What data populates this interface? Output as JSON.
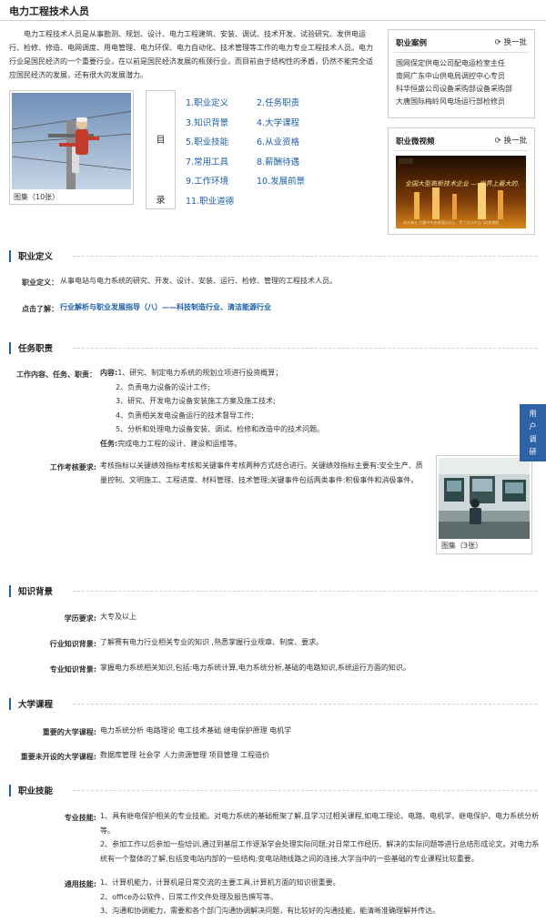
{
  "page_title": "电力工程技术人员",
  "intro": "电力工程技术人员是从事勘测、规划、设计、电力工程建筑、安装、调试、技术开发、试验研究、发供电运行、检修、修造、电网调度、用电管理、电力环保、电力自动化、技术管理等工作的电力专业工程技术人员。电力行业是国民经济的一个重要行业，在以前是国民经济发展的瓶颈行业，而目前由于结构性的矛盾，仍然不能完全适应国民经济的发展，还有很大的发展潜力。",
  "photo": {
    "caption": "图集（10张）"
  },
  "toc": {
    "label_chars": [
      "目",
      "录"
    ],
    "items": [
      "1.职业定义",
      "2.任务职责",
      "3.知识背景",
      "4.大学课程",
      "5.职业技能",
      "6.从业资格",
      "7.常用工具",
      "8.薪酬待遇",
      "9.工作环境",
      "10.发展前景",
      "11.职业道德"
    ]
  },
  "case_box": {
    "title": "职业案例",
    "swap": "换一批",
    "items": [
      "国网保定供电公司配电运检室主任",
      "南网广东中山供电局调控中心专员",
      "科华恒盛公司设备采购部设备采购部",
      "大唐国际梅岭风电场运行部检修员"
    ]
  },
  "video_box": {
    "title": "职业微视频",
    "swap": "换一批",
    "video_overlay": "全国大型高新技术企业 — 世界上最大的...",
    "video_sub": "电力事业 打赢中华热地国际扫元，等了点力开仓门的热地影"
  },
  "s1": {
    "title": "职业定义",
    "def_label": "职业定义：",
    "def_text": "从事电站与电力系统的研究、开发、设计、安装、运行、检修、管理的工程技术人员。",
    "more_label": "点击了解：",
    "more_link": "行业解析与职业发展指导（八）——科技制造行业、清洁能源行业"
  },
  "s2": {
    "title": "任务职责",
    "duty_label": "工作内容、任务、职责：",
    "content_prefix": "内容:",
    "content_lines": [
      "1、研究、制定电力系统的规划立项进行投资概算；",
      "2、负责电力设备的设计工作;",
      "3、研究、开发电力设备安装施工方案及施工技术;",
      "4、负责相关发电设备运行的技术督导工作;",
      "5、分析和处理电力设备安装、调试、检修和改造中的技术问题。"
    ],
    "task_prefix": "任务:",
    "task_text": "完成电力工程的设计、建设和运维等。",
    "assess_label": "工作考核要求:",
    "assess_text": "考核指标以关键绩效指标考核和关键事件考核两种方式结合进行。关键绩效指标主要有:安全生产、质量控制、文明施工、工程进度、材料管理、技术管理;关键事件包括两类事件:积极事件和消极事件。",
    "photo_caption": "图集（3张）"
  },
  "float_button": [
    "用",
    "户",
    "调",
    "研"
  ],
  "s3": {
    "title": "知识背景",
    "rows": [
      {
        "label": "学历要求:",
        "value": "大专及以上"
      },
      {
        "label": "行业知识背景:",
        "value": "了解赛有电力行业相关专业的知识 ,熟悉掌握行业规章、制度、要求。"
      },
      {
        "label": "专业知识背景:",
        "value": "掌握电力系统相关知识,包括:电力系统计算,电力系统分析,基础的电路知识,系统运行方面的知识。"
      }
    ]
  },
  "s4": {
    "title": "大学课程",
    "rows": [
      {
        "label": "重要的大学课程:",
        "value": "电力系统分析 电路理论 电工技术基础 继电保护原理 电机学"
      },
      {
        "label": "重要未开设的大学课程:",
        "value": "数据库管理 社会学 人力资源管理 项目管理 工程造价"
      }
    ]
  },
  "s5": {
    "title": "职业技能",
    "pro_label": "专业技能:",
    "pro_lines": [
      "1、具有继电保护相关的专业技能。对电力系统的基础框架了解,且学习过相关课程,如电工理论、电路、电机学、继电保护、电力系统分析等。",
      "2、参加工作以后参加一些培训,通过到基层工作逐渐学会处理实际问题;对日常工作经历、解决的实际问题等进行总结形成论文。对电力系统有一个整体的了解,包括变电站内部的一些结构;变电站随线路之间的连接,大学当中的一些基础的专业课程比较重要。"
    ],
    "gen_label": "通用技能:",
    "gen_lines": [
      "1、计算机能力，计算机是日常交流的主要工具,计算机方面的知识很重要。",
      "2、office办公软件，日常工作文件处理及报告撰写等。",
      "3、沟通和协调能力，需要和各个部门沟通协调解决问题，有比较好的沟通技能，能清晰准确理解并传达。"
    ]
  }
}
